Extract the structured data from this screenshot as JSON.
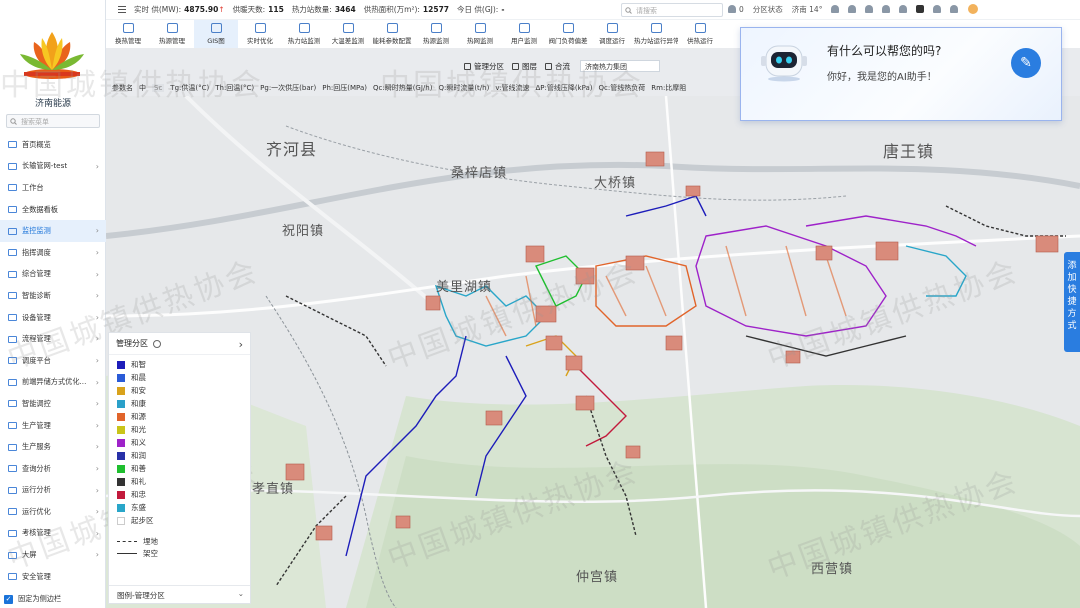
{
  "brand": {
    "name": "济南能源",
    "search_placeholder": "搜索菜单"
  },
  "sidebar": {
    "items": [
      {
        "label": "首页概览",
        "chev": false
      },
      {
        "label": "长输管网-test",
        "chev": true
      },
      {
        "label": "工作台",
        "chev": false
      },
      {
        "label": "全数据看板",
        "chev": false
      },
      {
        "label": "监控监测",
        "chev": true,
        "active": true
      },
      {
        "label": "指挥调度",
        "chev": true
      },
      {
        "label": "综合管理",
        "chev": true
      },
      {
        "label": "智能诊断",
        "chev": true
      },
      {
        "label": "设备管理",
        "chev": true
      },
      {
        "label": "流程管理",
        "chev": true
      },
      {
        "label": "调度平台",
        "chev": true
      },
      {
        "label": "前端异储方式优化...",
        "chev": true
      },
      {
        "label": "智能调控",
        "chev": true
      },
      {
        "label": "生产管理",
        "chev": true
      },
      {
        "label": "生产服务",
        "chev": true
      },
      {
        "label": "查询分析",
        "chev": true
      },
      {
        "label": "运行分析",
        "chev": true
      },
      {
        "label": "运行优化",
        "chev": true
      },
      {
        "label": "考核管理",
        "chev": true
      },
      {
        "label": "大屏",
        "chev": true
      },
      {
        "label": "安全管理",
        "chev": false
      }
    ],
    "pin_label": "固定为侧边栏"
  },
  "topbar": {
    "stats": [
      {
        "label": "实时 供(MW):",
        "value": "4875.90",
        "up": "↑"
      },
      {
        "label": "供暖天数:",
        "value": "115"
      },
      {
        "label": "热力站数量:",
        "value": "3464"
      },
      {
        "label": "供热面积(万m²):",
        "value": "12577"
      },
      {
        "label": "今日 供(GJ):",
        "value": "-"
      }
    ],
    "search_placeholder": "请搜索",
    "notif_count": "0",
    "region_status": "分区状态",
    "weather": "济南 14°"
  },
  "toolbar": {
    "tools": [
      "换热管理",
      "热源管理",
      "GIS图",
      "实时优化",
      "热力站监测",
      "大温差监测",
      "能耗参数配置",
      "热源监测",
      "热网监测",
      "用户监测",
      "阀门负荷偏差",
      "调度运行",
      "热力站运行异常",
      "供热运行"
    ]
  },
  "subbar": {
    "zone_label": "管理分区",
    "layer_label": "图层",
    "merge_label": "合流",
    "company": "济南热力集团"
  },
  "legend_bar": [
    "参数名",
    "中",
    "Sc",
    "Tg:供温(°C)",
    "Th:回温(°C)",
    "Pg:一次供压(bar)",
    "Ph:回压(MPa)",
    "Qc:瞬时热量(GJ/h)",
    "Q:瞬时流量(t/h)",
    "v:管线流速",
    "ΔP:管线压降(kPa)",
    "Qc:管线热负荷",
    "Rm:比摩阻"
  ],
  "map": {
    "places": [
      {
        "name": "齐河县",
        "cls": ""
      },
      {
        "name": "桑梓店镇",
        "cls": "sm"
      },
      {
        "name": "大桥镇",
        "cls": "sm"
      },
      {
        "name": "唐王镇",
        "cls": ""
      },
      {
        "name": "祝阳镇",
        "cls": "sm"
      },
      {
        "name": "美里湖镇",
        "cls": "sm"
      },
      {
        "name": "仲宫镇",
        "cls": "sm"
      },
      {
        "name": "西营镇",
        "cls": "sm"
      },
      {
        "name": "孝直镇",
        "cls": "sm"
      }
    ],
    "watermark": "中国城镇供热协会"
  },
  "zones_panel": {
    "title": "管理分区",
    "zones": [
      {
        "name": "和智",
        "color": "#1d1dba"
      },
      {
        "name": "和晨",
        "color": "#2a5bd7"
      },
      {
        "name": "和安",
        "color": "#d9a21b"
      },
      {
        "name": "和康",
        "color": "#2aa0c9"
      },
      {
        "name": "和源",
        "color": "#e1642a"
      },
      {
        "name": "和光",
        "color": "#c9c419"
      },
      {
        "name": "和义",
        "color": "#9e22c9"
      },
      {
        "name": "和润",
        "color": "#2831a8"
      },
      {
        "name": "和善",
        "color": "#1fbf2f"
      },
      {
        "name": "和礼",
        "color": "#333333"
      },
      {
        "name": "和忠",
        "color": "#c21a3c"
      },
      {
        "name": "东盛",
        "color": "#29a6c9"
      },
      {
        "name": "起步区",
        "color": "#ffffff"
      }
    ],
    "line_types": [
      {
        "name": "埋地",
        "style": "dashed"
      },
      {
        "name": "架空",
        "style": "solid"
      }
    ],
    "footer": "图例-管理分区"
  },
  "ai": {
    "question": "有什么可以帮您的吗?",
    "answer": "你好，我是您的AI助手！"
  },
  "quick_add": "添加快捷方式"
}
